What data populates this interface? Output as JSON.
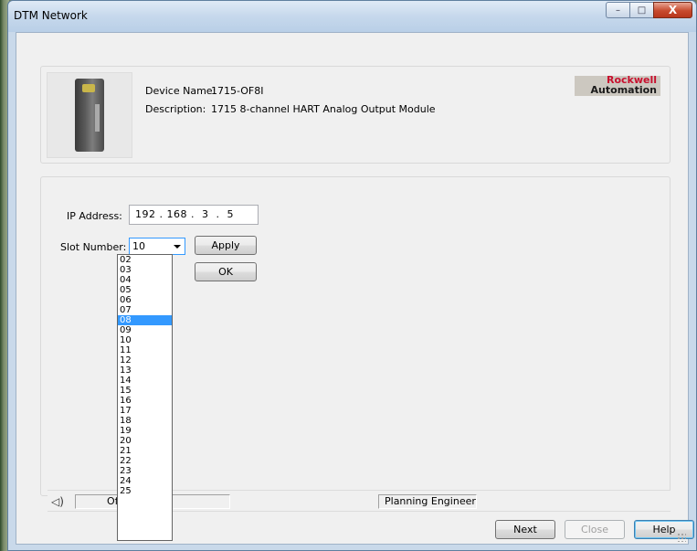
{
  "window": {
    "title": "DTM Network"
  },
  "titlebar_buttons": {
    "minimize": "–",
    "maximize": "□",
    "close": "X"
  },
  "device": {
    "name_label": "Device Name:",
    "name_value": "1715-OF8I",
    "description_label": "Description:",
    "description_value": "1715 8-channel HART Analog Output Module",
    "image_icon": "device-module-icon"
  },
  "brand": {
    "line1": "Rockwell",
    "line2": "Automation",
    "line1_color": "#c8102e"
  },
  "network": {
    "ip_label": "IP Address:",
    "ip_value": "192 . 168 .  3  .  5",
    "slot_label": "Slot Number:",
    "slot_value": "10",
    "slot_options": [
      "02",
      "03",
      "04",
      "05",
      "06",
      "07",
      "08",
      "09",
      "10",
      "11",
      "12",
      "13",
      "14",
      "15",
      "16",
      "17",
      "18",
      "19",
      "20",
      "21",
      "22",
      "23",
      "24",
      "25"
    ],
    "slot_highlighted": "08"
  },
  "buttons": {
    "apply": "Apply",
    "ok": "OK",
    "next": "Next",
    "close": "Close",
    "help": "Help"
  },
  "status": {
    "mode": "Offline",
    "user_role": "Planning Engineer",
    "speaker_icon": "speaker-icon"
  },
  "colors": {
    "selection": "#3399ff",
    "window_frame": "#c9d9ea",
    "client_bg": "#f0f0f0"
  }
}
